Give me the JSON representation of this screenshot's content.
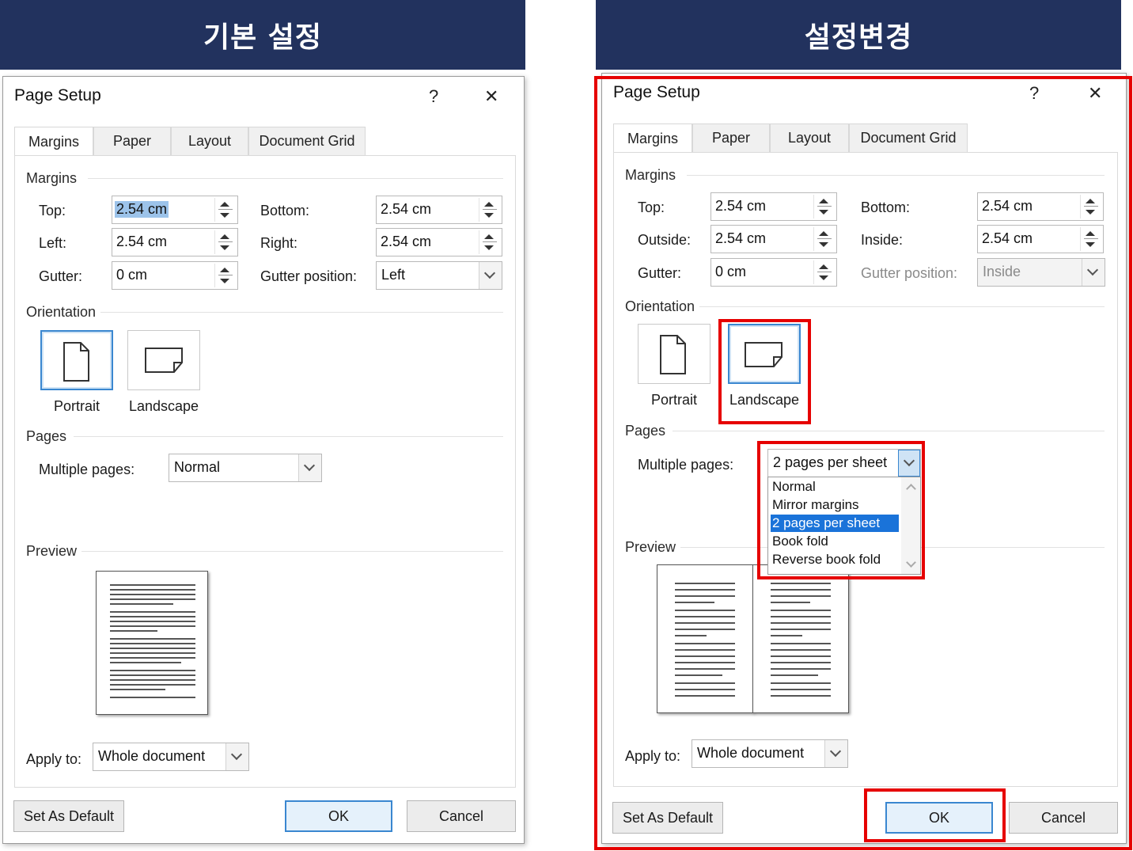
{
  "banners": {
    "left": "기본 설정",
    "right": "설정변경"
  },
  "dialog": {
    "title": "Page Setup",
    "help": "?",
    "close": "✕",
    "tabs": [
      "Margins",
      "Paper",
      "Layout",
      "Document Grid"
    ],
    "margins_group": "Margins",
    "orientation_group": "Orientation",
    "pages_group": "Pages",
    "preview_group": "Preview",
    "apply_to_label": "Apply to:",
    "apply_to_value": "Whole document",
    "set_default": "Set As Default",
    "ok": "OK",
    "cancel": "Cancel",
    "portrait": "Portrait",
    "landscape": "Landscape",
    "multiple_pages_label": "Multiple pages:"
  },
  "left": {
    "top_label": "Top:",
    "top": "2.54 cm",
    "bottom_label": "Bottom:",
    "bottom": "2.54 cm",
    "left_label": "Left:",
    "left": "2.54 cm",
    "right_label": "Right:",
    "right": "2.54 cm",
    "gutter_label": "Gutter:",
    "gutter": "0 cm",
    "gutter_pos_label": "Gutter position:",
    "gutter_pos": "Left",
    "multiple_pages": "Normal"
  },
  "right": {
    "top_label": "Top:",
    "top": "2.54 cm",
    "bottom_label": "Bottom:",
    "bottom": "2.54 cm",
    "outside_label": "Outside:",
    "outside": "2.54 cm",
    "inside_label": "Inside:",
    "inside": "2.54 cm",
    "gutter_label": "Gutter:",
    "gutter": "0 cm",
    "gutter_pos_label": "Gutter position:",
    "gutter_pos": "Inside",
    "multiple_pages": "2 pages per sheet",
    "options": [
      "Normal",
      "Mirror margins",
      "2 pages per sheet",
      "Book fold",
      "Reverse book fold"
    ],
    "selected_option": "2 pages per sheet"
  },
  "colors": {
    "banner": "#22325e",
    "highlight": "#e60000",
    "accent": "#3a87d0"
  }
}
